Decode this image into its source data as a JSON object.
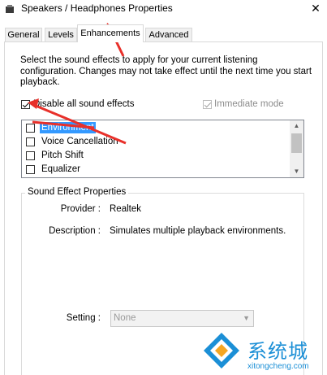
{
  "window": {
    "title": "Speakers / Headphones Properties",
    "close_glyph": "✕"
  },
  "tabs": [
    {
      "label": "General"
    },
    {
      "label": "Levels"
    },
    {
      "label": "Enhancements",
      "active": true
    },
    {
      "label": "Advanced"
    }
  ],
  "enhancements": {
    "description": "Select the sound effects to apply for your current listening configuration. Changes may not take effect until the next time you start playback.",
    "disable_all": {
      "label": "Disable all sound effects",
      "checked": true
    },
    "immediate_mode": {
      "label": "Immediate mode",
      "checked": true,
      "disabled": true
    },
    "effects": [
      {
        "label": "Environment",
        "checked": false,
        "selected": true
      },
      {
        "label": "Voice Cancellation",
        "checked": false
      },
      {
        "label": "Pitch Shift",
        "checked": false
      },
      {
        "label": "Equalizer",
        "checked": false
      }
    ],
    "properties": {
      "title": "Sound Effect Properties",
      "provider_label": "Provider :",
      "provider_value": "Realtek",
      "description_label": "Description :",
      "description_value": "Simulates multiple playback environments.",
      "setting_label": "Setting :",
      "setting_value": "None"
    }
  },
  "watermark": {
    "text": "系统城",
    "url": "xitongcheng.com"
  },
  "colors": {
    "selection": "#3399ff",
    "annotation_arrow": "#e8302a",
    "watermark": "#1b8fd6"
  }
}
